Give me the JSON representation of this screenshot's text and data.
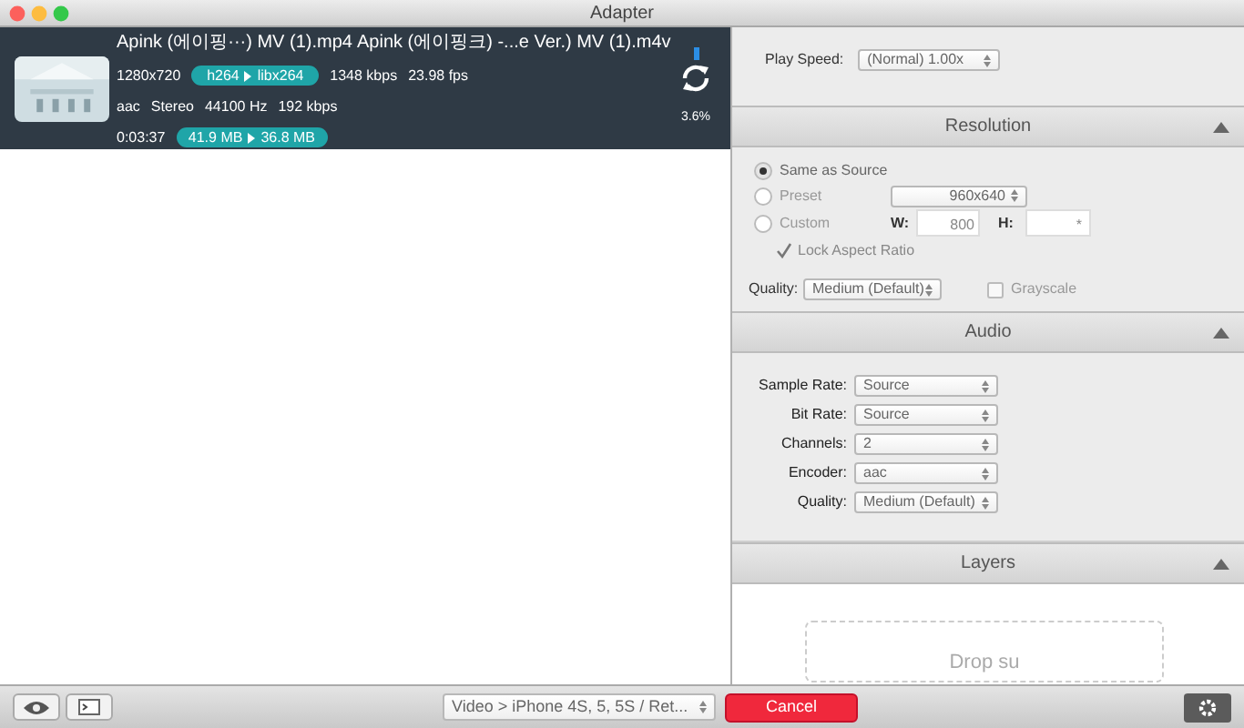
{
  "window": {
    "title": "Adapter"
  },
  "job": {
    "source_name": "Apink (에이핑···) MV (1).mp4",
    "output_name": "Apink (에이핑크) -...e Ver.) MV (1).m4v",
    "resolution": "1280x720",
    "codec_from": "h264",
    "codec_to": "libx264",
    "bitrate": "1348 kbps",
    "fps": "23.98 fps",
    "audio": [
      "aac",
      "Stereo",
      "44100 Hz",
      "192 kbps"
    ],
    "duration": "0:03:37",
    "size_from": "41.9 MB",
    "size_to": "36.8 MB",
    "progress": "3.6%"
  },
  "play_speed": {
    "label": "Play Speed:",
    "value": "(Normal) 1.00x"
  },
  "resolution": {
    "title": "Resolution",
    "options": [
      {
        "label": "Same as Source",
        "selected": true
      },
      {
        "label": "Preset",
        "selected": false
      },
      {
        "label": "Custom",
        "selected": false
      }
    ],
    "preset_value": "960x640",
    "width_label": "W:",
    "width_value": "800",
    "height_label": "H:",
    "height_value": "*",
    "lock": {
      "label": "Lock Aspect Ratio",
      "checked": true
    },
    "quality_label": "Quality:",
    "quality_value": "Medium (Default)",
    "grayscale": {
      "label": "Grayscale",
      "checked": false
    }
  },
  "audio": {
    "title": "Audio",
    "rows": [
      {
        "label": "Sample Rate:",
        "value": "Source"
      },
      {
        "label": "Bit Rate:",
        "value": "Source"
      },
      {
        "label": "Channels:",
        "value": "2"
      },
      {
        "label": "Encoder:",
        "value": "aac"
      },
      {
        "label": "Quality:",
        "value": "Medium (Default)"
      }
    ]
  },
  "layers": {
    "title": "Layers",
    "drop_text": "Drop su"
  },
  "bottom_bar": {
    "preset": "Video > iPhone 4S, 5, 5S / Ret...",
    "cancel": "Cancel"
  }
}
